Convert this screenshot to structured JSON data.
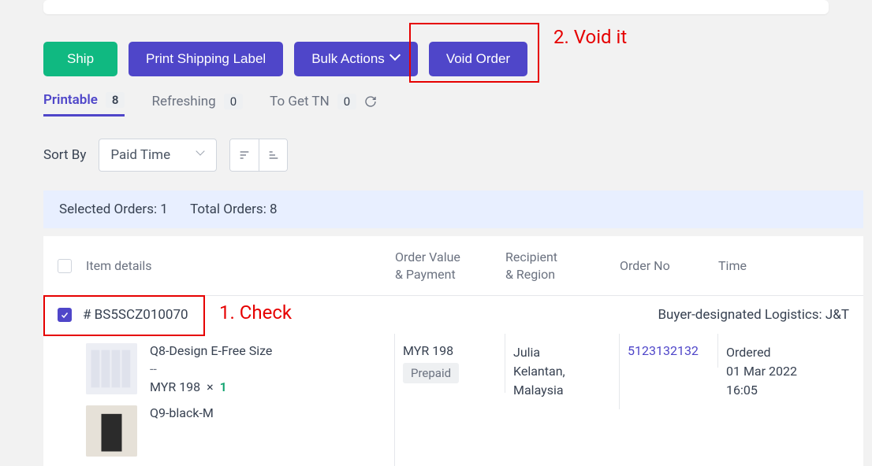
{
  "annotations": {
    "void": "2. Void it",
    "check": "1. Check"
  },
  "toolbar": {
    "ship": "Ship",
    "print_label": "Print Shipping Label",
    "bulk_actions": "Bulk Actions",
    "void_order": "Void Order"
  },
  "tabs": {
    "printable": {
      "label": "Printable",
      "count": "8"
    },
    "refreshing": {
      "label": "Refreshing",
      "count": "0"
    },
    "to_get_tn": {
      "label": "To Get TN",
      "count": "0"
    }
  },
  "sort": {
    "label": "Sort By",
    "value": "Paid Time"
  },
  "selection_bar": {
    "selected": "Selected Orders: 1",
    "total": "Total Orders: 8"
  },
  "table": {
    "headers": {
      "item_details": "Item details",
      "order_value_l1": "Order Value",
      "order_value_l2": "& Payment",
      "recipient_l1": "Recipient",
      "recipient_l2": "& Region",
      "order_no": "Order No",
      "time": "Time"
    }
  },
  "order": {
    "number": "# BS5SCZ010070",
    "logistics": "Buyer-designated Logistics: J&T",
    "items": [
      {
        "name": "Q8-Design E-Free Size",
        "sub": "--",
        "price": "MYR 198",
        "times": "×",
        "qty": "1"
      },
      {
        "name": "Q9-black-M"
      }
    ],
    "value": "MYR 198",
    "payment_badge": "Prepaid",
    "recipient_name": "Julia",
    "recipient_region": "Kelantan, Malaysia",
    "order_no": "5123132132",
    "status": "Ordered",
    "time": "01 Mar 2022 16:05"
  }
}
